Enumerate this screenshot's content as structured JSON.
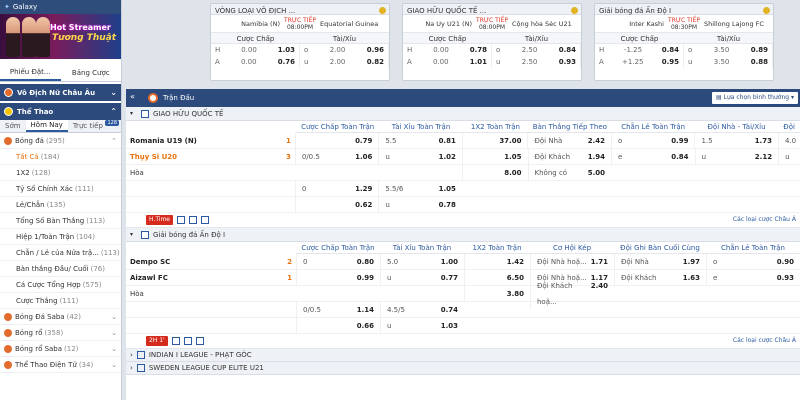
{
  "sidebar": {
    "galaxy": "Galaxy",
    "banner_line1": "Hot Streamer",
    "banner_line2": "Tương Thuật",
    "tabs": [
      "Phiếu Đặt...",
      "Bảng Cược"
    ],
    "section1": "Vô Địch Nữ Châu Âu",
    "section2": "Thể Thao",
    "timetabs": [
      "Sớm",
      "Hôm Nay",
      "Trực tiếp"
    ],
    "live_badge": "128",
    "items": [
      {
        "label": "Bóng đá",
        "count": "(295)",
        "head": true
      },
      {
        "label": "Tất Cả",
        "count": "(184)",
        "active": true
      },
      {
        "label": "1X2",
        "count": "(128)"
      },
      {
        "label": "Tỷ Số Chính Xác",
        "count": "(111)"
      },
      {
        "label": "Lẻ/Chẵn",
        "count": "(135)"
      },
      {
        "label": "Tổng Số Bàn Thắng",
        "count": "(113)"
      },
      {
        "label": "Hiệp 1/Toàn Trận",
        "count": "(104)"
      },
      {
        "label": "Chẵn / Lẻ của Nửa trậ...",
        "count": "(113)"
      },
      {
        "label": "Bàn thắng Đầu/ Cuối",
        "count": "(76)"
      },
      {
        "label": "Cá Cược Tổng Hợp",
        "count": "(575)"
      },
      {
        "label": "Cược Thắng",
        "count": "(111)"
      }
    ],
    "sports": [
      {
        "label": "Bóng Đá Saba",
        "count": "(42)"
      },
      {
        "label": "Bóng rổ",
        "count": "(358)"
      },
      {
        "label": "Bóng rổ Saba",
        "count": "(12)"
      },
      {
        "label": "Thể Thao Điện Tử",
        "count": "(34)"
      }
    ]
  },
  "cards": [
    {
      "league": "VÒNG LOẠI VÔ ĐỊCH ...",
      "home": "Namibia (N)",
      "away": "Equatorial Guinea",
      "status": "TRỰC TIẾP",
      "time": "08:00PM",
      "h1": "Cược Chấp",
      "h2": "Tài/Xỉu",
      "rows": [
        [
          "H",
          "0.00",
          "1.03",
          "o",
          "2.00",
          "0.96"
        ],
        [
          "A",
          "0.00",
          "0.76",
          "u",
          "2.00",
          "0.82"
        ]
      ]
    },
    {
      "league": "GIAO HỮU QUỐC TẾ ...",
      "home": "Na Uy U21 (N)",
      "away": "Cộng hòa Séc U21",
      "status": "TRỰC TIẾP",
      "time": "08:00PM",
      "h1": "Cược Chấp",
      "h2": "Tài/Xỉu",
      "rows": [
        [
          "H",
          "0.00",
          "0.78",
          "o",
          "2.50",
          "0.84"
        ],
        [
          "A",
          "0.00",
          "1.01",
          "u",
          "2.50",
          "0.93"
        ]
      ]
    },
    {
      "league": "Giải bóng đá Ấn Độ I",
      "home": "Inter Kashi",
      "away": "Shillong Lajong FC",
      "status": "TRỰC TIẾP",
      "time": "08:30PM",
      "h1": "Cược Chấp",
      "h2": "Tài/Xỉu",
      "rows": [
        [
          "H",
          "-1.25",
          "0.84",
          "o",
          "3.50",
          "0.89"
        ],
        [
          "A",
          "+1.25",
          "0.95",
          "u",
          "3.50",
          "0.88"
        ]
      ]
    }
  ],
  "main": {
    "header": "Trận Đấu",
    "sort": "Lựa chọn bình thường",
    "league1": {
      "name": "GIAO HỮU QUỐC TẾ",
      "cols": [
        "Cược Chấp Toàn Trận",
        "Tài Xỉu Toàn Trận",
        "1X2 Toàn Trận",
        "Bàn Thắng Tiếp Theo",
        "Chẵn Lẻ Toàn Trận",
        "Đội Nhà - Tài/Xỉu",
        "Đội"
      ],
      "home": "Romania U19 (N)",
      "home_score": "1",
      "away": "Thụy Sĩ U20",
      "away_score": "3",
      "draw": "Hòa",
      "rows": [
        [
          [
            "",
            "0.79"
          ],
          [
            "5.5",
            "0.81"
          ],
          [
            "",
            "37.00"
          ],
          [
            "Đội Nhà",
            "2.42"
          ],
          [
            "o",
            "0.99"
          ],
          [
            "1.5",
            "1.73"
          ],
          [
            "4.0",
            ""
          ]
        ],
        [
          [
            "0/0.5",
            "1.06"
          ],
          [
            "u",
            "1.02"
          ],
          [
            "",
            "1.05"
          ],
          [
            "Đội Khách",
            "1.94"
          ],
          [
            "e",
            "0.84"
          ],
          [
            "u",
            "2.12"
          ],
          [
            "u",
            ""
          ]
        ],
        [
          [
            "",
            ""
          ],
          [
            "",
            ""
          ],
          [
            "",
            "8.00"
          ],
          [
            "Không có",
            "5.00"
          ],
          [
            "",
            ""
          ],
          [
            "",
            ""
          ],
          [
            "",
            ""
          ]
        ],
        [
          [
            "0",
            "1.29"
          ],
          [
            "5.5/6",
            "1.05"
          ],
          [
            "",
            ""
          ],
          [
            "",
            ""
          ],
          [
            "",
            ""
          ],
          [
            "",
            ""
          ],
          [
            "",
            ""
          ]
        ],
        [
          [
            "",
            "0.62"
          ],
          [
            "u",
            "0.78"
          ],
          [
            "",
            ""
          ],
          [
            "",
            ""
          ],
          [
            "",
            ""
          ],
          [
            "",
            ""
          ],
          [
            "",
            ""
          ]
        ]
      ],
      "chip": "H.Time",
      "other": "Các loại cược Châu Á"
    },
    "league2": {
      "name": "Giải bóng đá Ấn Độ I",
      "cols": [
        "Cược Chấp Toàn Trận",
        "Tài Xỉu Toàn Trận",
        "1X2 Toàn Trận",
        "Cơ Hội Kép",
        "Đội Ghi Bàn Cuối Cùng",
        "Chẵn Lẻ Toàn Trận"
      ],
      "home": "Dempo SC",
      "home_score": "2",
      "away": "Aizawl FC",
      "away_score": "1",
      "draw": "Hòa",
      "rows": [
        [
          [
            "0",
            "0.80"
          ],
          [
            "5.0",
            "1.00"
          ],
          [
            "",
            "1.42"
          ],
          [
            "Đội Nhà hoặ...",
            "1.71"
          ],
          [
            "Đội Nhà",
            "1.97"
          ],
          [
            "o",
            "0.90"
          ]
        ],
        [
          [
            "",
            "0.99"
          ],
          [
            "u",
            "0.77"
          ],
          [
            "",
            "6.50"
          ],
          [
            "Đội Nhà hoặ...",
            "1.17"
          ],
          [
            "Đội Khách",
            "1.63"
          ],
          [
            "e",
            "0.93"
          ]
        ],
        [
          [
            "",
            ""
          ],
          [
            "",
            ""
          ],
          [
            "",
            "3.80"
          ],
          [
            "Đội Khách hoặ...",
            "2.40"
          ],
          [
            "",
            ""
          ],
          [
            "",
            ""
          ]
        ],
        [
          [
            "0/0.5",
            "1.14"
          ],
          [
            "4.5/5",
            "0.74"
          ],
          [
            "",
            ""
          ],
          [
            "",
            ""
          ],
          [
            "",
            ""
          ],
          [
            "",
            ""
          ]
        ],
        [
          [
            "",
            "0.66"
          ],
          [
            "u",
            "1.03"
          ],
          [
            "",
            ""
          ],
          [
            "",
            ""
          ],
          [
            "",
            ""
          ],
          [
            "",
            ""
          ]
        ]
      ],
      "chip": "2H 1'",
      "other": "Các loại cược Châu Á"
    },
    "collapsed": [
      "INDIAN I LEAGUE - PHẠT GÓC",
      "SWEDEN LEAGUE CUP ELITE U21"
    ]
  }
}
